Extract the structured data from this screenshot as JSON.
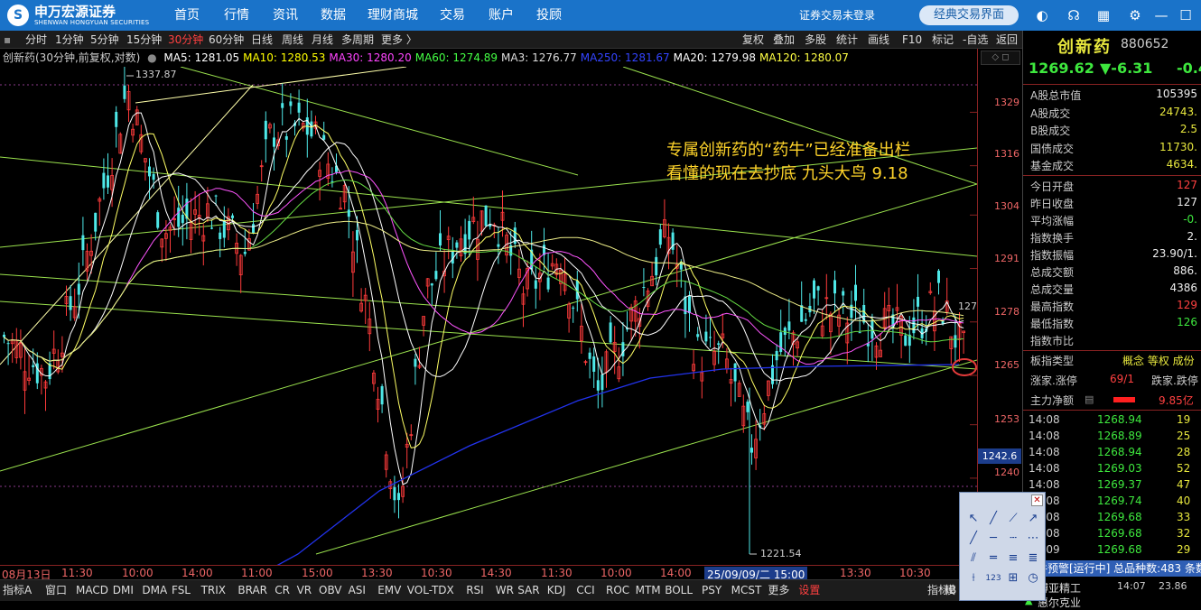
{
  "topnav": {
    "logo_cn": "申万宏源证券",
    "logo_en": "SHENWAN HONGYUAN SECURITIES",
    "items": [
      "首页",
      "行情",
      "资讯",
      "数据",
      "理财商城",
      "交易",
      "账户",
      "投顾"
    ],
    "login_status": "证券交易未登录",
    "classic_button": "经典交易界面"
  },
  "toolbar": {
    "periods": [
      "分时",
      "1分钟",
      "5分钟",
      "15分钟",
      "30分钟",
      "60分钟",
      "日线",
      "周线",
      "月线",
      "多周期",
      "更多 〉"
    ],
    "active_period": "30分钟",
    "right_items": [
      "复权",
      "叠加",
      "多股",
      "统计",
      "画线",
      "F10",
      "标记",
      "-自选",
      "返回"
    ]
  },
  "ma_bar": {
    "title": "创新药(30分钟,前复权,对数)",
    "items": [
      {
        "label": "MA5: 1281.05",
        "color": "#ffffff"
      },
      {
        "label": "MA10: 1280.53",
        "color": "#ffff00"
      },
      {
        "label": "MA30: 1280.20",
        "color": "#ff44ff"
      },
      {
        "label": "MA60: 1274.89",
        "color": "#44ff44"
      },
      {
        "label": "MA3: 1276.77",
        "color": "#dddddd"
      },
      {
        "label": "MA250: 1281.67",
        "color": "#3344ff"
      },
      {
        "label": "MA20: 1279.98",
        "color": "#ffffff"
      },
      {
        "label": "MA120: 1280.07",
        "color": "#ffff44"
      }
    ]
  },
  "chart": {
    "high_label": "1337.87",
    "low_label": "1221.54",
    "price_axis": [
      "1329",
      "1316",
      "1304",
      "1291",
      "1278",
      "1265",
      "1253",
      "1240"
    ],
    "current_price_tag": "127",
    "cursor_price": "1242.6",
    "annotation_line1": "专属创新药的“药牛”已经准备出栏",
    "annotation_line2": "看懂的现在去抄底   九头大鸟 9.18",
    "time_labels": [
      "08月13日",
      "11:30",
      "10:00",
      "14:00",
      "11:00",
      "15:00",
      "13:30",
      "10:30",
      "14:30",
      "11:30",
      "10:00",
      "14:00",
      "25/09/09/二 15:00",
      "13:30",
      "10:30"
    ]
  },
  "indicators": {
    "items": [
      "指标A",
      "窗口",
      "MACD",
      "DMI",
      "DMA",
      "FSL",
      "TRIX",
      "BRAR",
      "CR",
      "VR",
      "OBV",
      "ASI",
      "EMV",
      "VOL-TDX",
      "RSI",
      "WR",
      "SAR",
      "KDJ",
      "CCI",
      "ROC",
      "MTM",
      "BOLL",
      "PSY",
      "MCST",
      "更多",
      "设置"
    ],
    "right": [
      "指标B",
      "模"
    ]
  },
  "right_panel": {
    "name": "创新药",
    "code": "880652",
    "price": "1269.62",
    "change": "▼-6.31",
    "pct": "-0.4",
    "rows": [
      {
        "label": "A股总市值",
        "value": "105395"
      },
      {
        "label": "A股成交",
        "value": "24743."
      },
      {
        "label": "B股成交",
        "value": "2.5"
      },
      {
        "label": "国债成交",
        "value": "11730."
      },
      {
        "label": "基金成交",
        "value": "4634."
      },
      {
        "label": "今日开盘",
        "value": "127"
      },
      {
        "label": "昨日收盘",
        "value": "127"
      },
      {
        "label": "平均涨幅",
        "value": "-0."
      },
      {
        "label": "指数换手",
        "value": "2."
      },
      {
        "label": "指数振幅",
        "value": "23.90/1."
      },
      {
        "label": "总成交额",
        "value": "886."
      },
      {
        "label": "总成交量",
        "value": "4386"
      },
      {
        "label": "最高指数",
        "value": "129"
      },
      {
        "label": "最低指数",
        "value": "126"
      },
      {
        "label": "指数市比",
        "value": ""
      }
    ],
    "board_type_label": "板指类型",
    "board_type_value": "概念 等权 成份",
    "updown_label": "涨家.涨停",
    "updown_value": "69/1",
    "downdown_label": "跌家.跌停",
    "mainflow_label": "主力净额",
    "mainflow_value": "9.85亿",
    "ticks": [
      {
        "time": "14:08",
        "price": "1268.94",
        "vol": "19"
      },
      {
        "time": "14:08",
        "price": "1268.89",
        "vol": "25"
      },
      {
        "time": "14:08",
        "price": "1268.94",
        "vol": "28"
      },
      {
        "time": "14:08",
        "price": "1269.03",
        "vol": "52"
      },
      {
        "time": "14:08",
        "price": "1269.37",
        "vol": "47"
      },
      {
        "time": "14:08",
        "price": "1269.74",
        "vol": "40"
      },
      {
        "time": "14:08",
        "price": "1269.68",
        "vol": "33"
      },
      {
        "time": "14:08",
        "price": "1269.68",
        "vol": "32"
      },
      {
        "time": "14:09",
        "price": "1269.68",
        "vol": "29"
      }
    ],
    "alert_bar": "条件预警[运行中] 总品种数:483 条数",
    "alert_rows": [
      {
        "name": "博亚精工",
        "time": "14:07",
        "val": "23.86"
      },
      {
        "name": "惠尔克业",
        "time": "14:07",
        "val": ""
      }
    ]
  }
}
